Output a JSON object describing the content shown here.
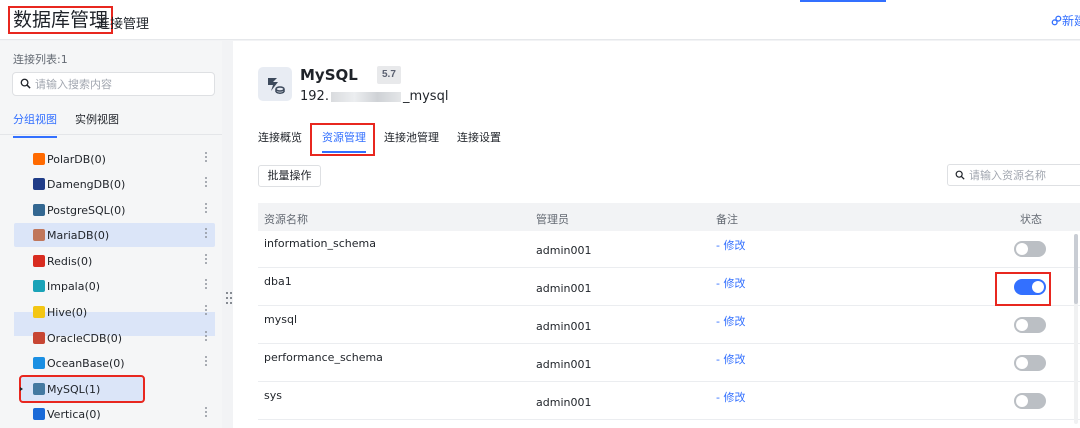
{
  "header": {
    "title": "数据库管理",
    "subnav": "连接管理",
    "new_button": "新建"
  },
  "colors": {
    "accent": "#3370ff",
    "highlight_box": "#e8271f"
  },
  "sidebar": {
    "count_label": "连接列表:1",
    "search_placeholder": "请输入搜索内容",
    "view_tabs": [
      "分组视图",
      "实例视图"
    ],
    "items": [
      {
        "label": "PolarDB(0)",
        "icon": "polardb-icon",
        "color": "#ff6a00"
      },
      {
        "label": "DamengDB(0)",
        "icon": "damengdb-icon",
        "color": "#1f3c88"
      },
      {
        "label": "PostgreSQL(0)",
        "icon": "postgresql-icon",
        "color": "#336791"
      },
      {
        "label": "MariaDB(0)",
        "icon": "mariadb-icon",
        "color": "#c0765a"
      },
      {
        "label": "Redis(0)",
        "icon": "redis-icon",
        "color": "#d82c20"
      },
      {
        "label": "Impala(0)",
        "icon": "impala-icon",
        "color": "#1aa3b8"
      },
      {
        "label": "Hive(0)",
        "icon": "hive-icon",
        "color": "#fdee21"
      },
      {
        "label": "OracleCDB(0)",
        "icon": "oraclecdb-icon",
        "color": "#c74634"
      },
      {
        "label": "OceanBase(0)",
        "icon": "oceanbase-icon",
        "color": "#1a8fe3"
      },
      {
        "label": "MySQL(1)",
        "icon": "mysql-icon",
        "color": "#4479a1"
      },
      {
        "label": "Vertica(0)",
        "icon": "vertica-icon",
        "color": "#1a6ad8"
      }
    ]
  },
  "main": {
    "db_name": "MySQL",
    "db_version": "5.7",
    "host_prefix": "192.",
    "host_suffix": "_mysql",
    "tabs": [
      "连接概览",
      "资源管理",
      "连接池管理",
      "连接设置"
    ],
    "active_tab": "资源管理",
    "batch_button": "批量操作",
    "resource_search_placeholder": "请输入资源名称",
    "table": {
      "headers": [
        "资源名称",
        "管理员",
        "备注",
        "状态"
      ],
      "rows": [
        {
          "name": "information_schema",
          "admin": "admin001",
          "note": "- 修改",
          "enabled": false
        },
        {
          "name": "dba1",
          "admin": "admin001",
          "note": "- 修改",
          "enabled": true
        },
        {
          "name": "mysql",
          "admin": "admin001",
          "note": "- 修改",
          "enabled": false
        },
        {
          "name": "performance_schema",
          "admin": "admin001",
          "note": "- 修改",
          "enabled": false
        },
        {
          "name": "sys",
          "admin": "admin001",
          "note": "- 修改",
          "enabled": false
        }
      ]
    }
  }
}
